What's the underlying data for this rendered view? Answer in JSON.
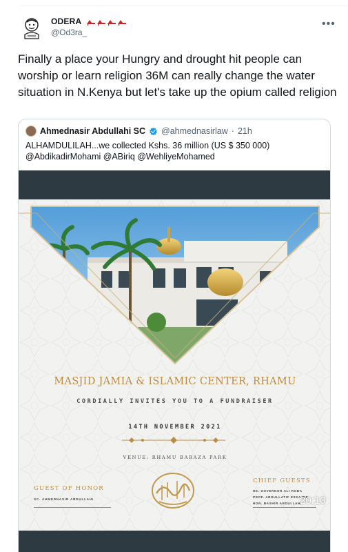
{
  "tweet": {
    "author_name": "ODERA",
    "author_handle": "@Od3ra_",
    "text": "Finally a place your Hungry and drought hit people can worship or learn religion 36M can really change the water situation in N.Kenya but let's take up the opium called religion",
    "more_icon": "more-horizontal-icon",
    "name_emojis": [
      "high-heel-icon",
      "high-heel-icon",
      "high-heel-icon",
      "high-heel-icon"
    ]
  },
  "quoted": {
    "author_name": "Ahmednasir Abdullahi SC",
    "author_handle": "@ahmednasirlaw",
    "separator": "·",
    "time": "21h",
    "text": "ALHAMDULILAH...we collected Kshs. 36 million (US $ 350 000)\n@AbdikadirMohami @ABiriq @WehliyeMohamed",
    "verified_icon": "verified-badge-icon",
    "verified_color": "#1d9bf0"
  },
  "poster": {
    "title": "MASJID JAMIA & ISLAMIC CENTER, RHAMU",
    "invite": "CORDIALLY INVITES YOU TO A FUNDRAISER",
    "date": "14TH NOVEMBER 2021",
    "venue": "VENUE: RHAMU BARAZA PARK",
    "guest_label": "GUEST OF HONOR",
    "guest_name": "SC. AHMEDNASIR ABDULLAHI",
    "chief_label": "CHIEF GUESTS",
    "chief_guests": [
      "HE. GOVERNOR ALI ROBA",
      "PROF. ABDULLATIF ESSAJEE",
      "HON. BASHIR ABDULLAHI"
    ],
    "accent_color": "#b98d46"
  },
  "video": {
    "timer": "20:10"
  }
}
